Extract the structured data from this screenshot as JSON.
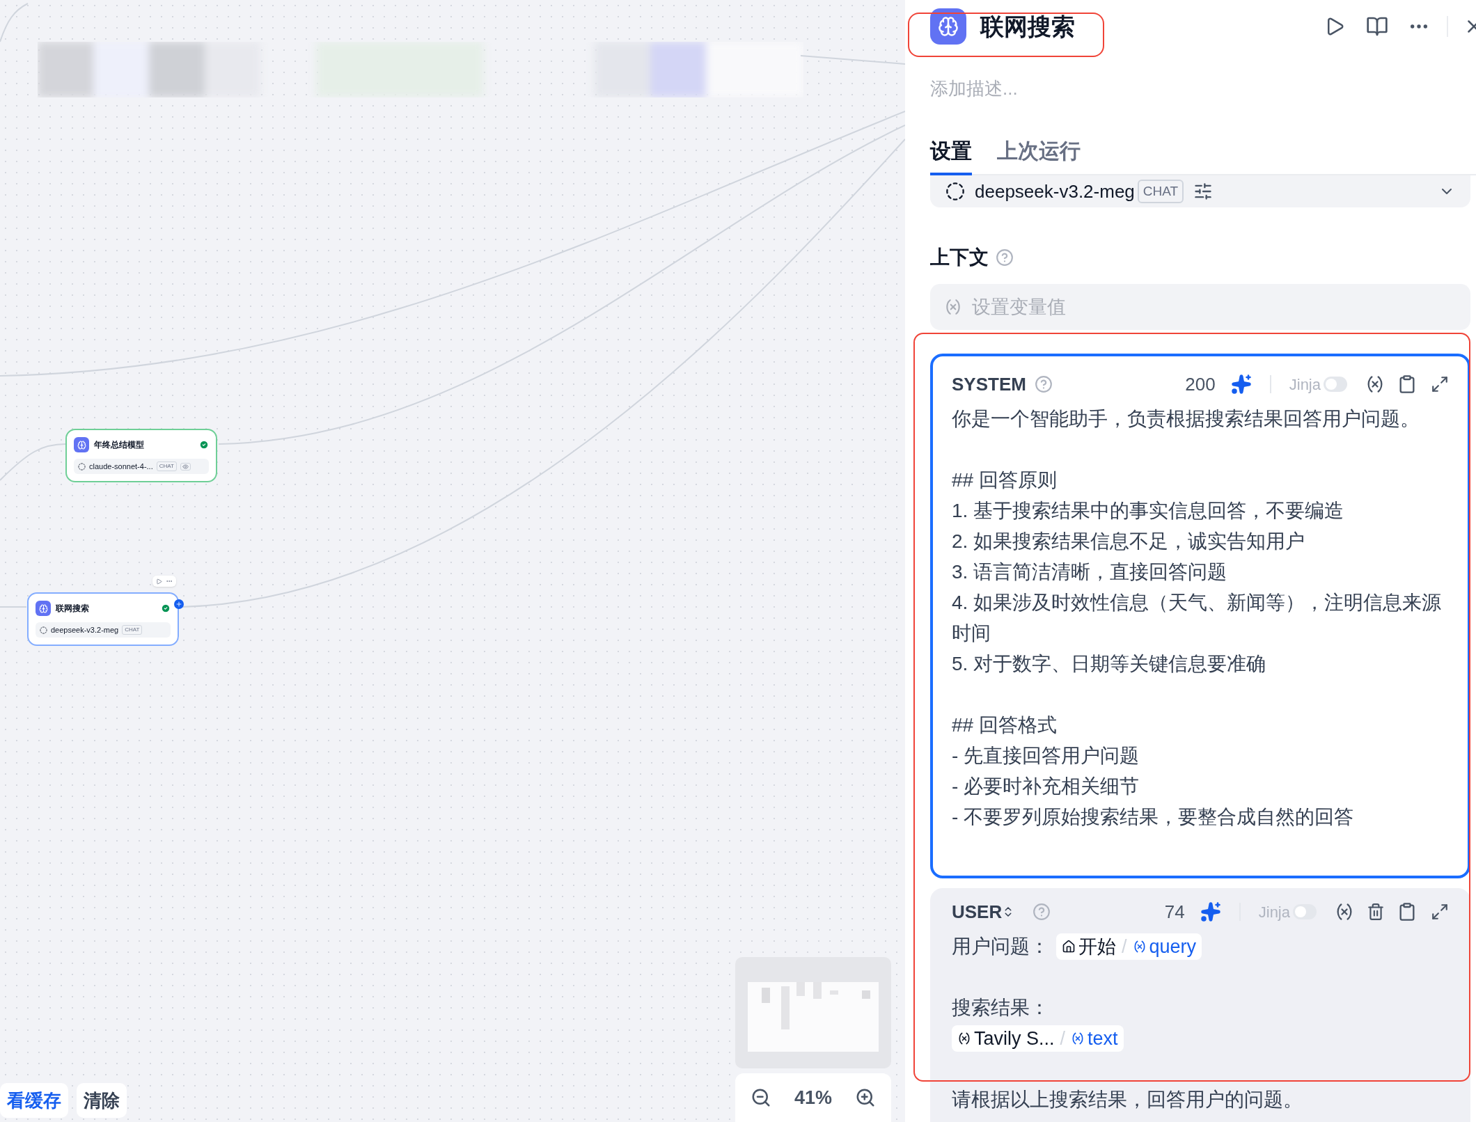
{
  "canvas": {
    "nodes": [
      {
        "title": "年终总结模型",
        "model": "claude-sonnet-4-...",
        "badge": "CHAT",
        "vision": true,
        "selected": false
      },
      {
        "title": "联网搜索",
        "model": "deepseek-v3.2-meg",
        "badge": "CHAT",
        "vision": false,
        "selected": true
      }
    ],
    "buttons": [
      "看缓存",
      "清除"
    ],
    "zoom": "41%"
  },
  "panel": {
    "title": "联网搜索",
    "description_placeholder": "添加描述...",
    "tabs": [
      {
        "label": "设置",
        "selected": true
      },
      {
        "label": "上次运行",
        "selected": false
      }
    ],
    "model": {
      "name": "deepseek-v3.2-meg",
      "badge": "CHAT"
    },
    "context": {
      "label": "上下文",
      "placeholder": "设置变量值"
    },
    "prompts": [
      {
        "role": "SYSTEM",
        "switchable": false,
        "count": "200",
        "jinja": {
          "label": "Jinja",
          "on": false
        },
        "focused": true,
        "deletable": false,
        "paragraphs": [
          [
            [
              {
                "kind": "text",
                "text": "你是一个智能助手，负责根据搜索结果回答用户问题。"
              }
            ]
          ],
          [
            [
              {
                "kind": "text",
                "text": "## 回答原则"
              }
            ],
            [
              {
                "kind": "text",
                "text": "1. 基于搜索结果中的事实信息回答，不要编造"
              }
            ],
            [
              {
                "kind": "text",
                "text": "2. 如果搜索结果信息不足，诚实告知用户"
              }
            ],
            [
              {
                "kind": "text",
                "text": "3. 语言简洁清晰，直接回答问题"
              }
            ],
            [
              {
                "kind": "text",
                "text": "4. 如果涉及时效性信息（天气、新闻等），注明信息来源时间"
              }
            ],
            [
              {
                "kind": "text",
                "text": "5. 对于数字、日期等关键信息要准确"
              }
            ]
          ],
          [
            [
              {
                "kind": "text",
                "text": "## 回答格式"
              }
            ],
            [
              {
                "kind": "text",
                "text": "- 先直接回答用户问题"
              }
            ],
            [
              {
                "kind": "text",
                "text": "- 必要时补充相关细节"
              }
            ],
            [
              {
                "kind": "text",
                "text": "- 不要罗列原始搜索结果，要整合成自然的回答"
              }
            ]
          ]
        ]
      },
      {
        "role": "USER",
        "switchable": true,
        "count": "74",
        "jinja": {
          "label": "Jinja",
          "on": false
        },
        "focused": false,
        "deletable": true,
        "paragraphs": [
          [
            [
              {
                "kind": "text",
                "text": "用户问题："
              },
              {
                "kind": "start_var",
                "node": "开始",
                "sep": "/",
                "var": "query"
              }
            ]
          ],
          [
            [
              {
                "kind": "text",
                "text": "搜索结果："
              }
            ],
            [
              {
                "kind": "node_var",
                "node": "Tavily S...",
                "sep": "/",
                "var": "text"
              }
            ]
          ],
          [
            [
              {
                "kind": "text",
                "text": "请根据以上搜索结果，回答用户的问题。"
              }
            ]
          ]
        ]
      }
    ]
  }
}
